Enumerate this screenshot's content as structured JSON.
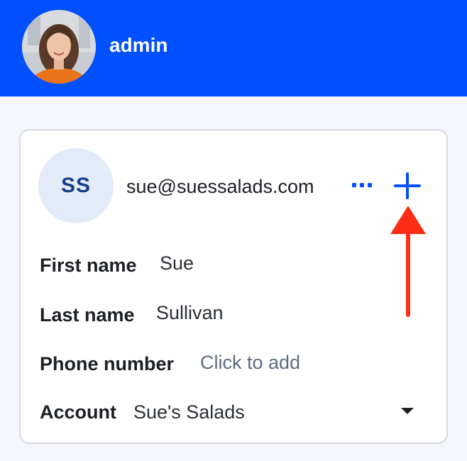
{
  "header": {
    "username": "admin",
    "background_color": "#0050ff",
    "avatar_icon": "user-photo-icon"
  },
  "contact": {
    "initials": "SS",
    "email": "sue@suessalads.com",
    "more_icon": "ellipsis-icon",
    "add_icon": "plus-icon",
    "accent_color": "#0050ff",
    "annotation_icon": "red-arrow-icon",
    "annotation_color": "#ff2d16",
    "fields": {
      "first_name": {
        "label": "First name",
        "value": "Sue"
      },
      "last_name": {
        "label": "Last name",
        "value": "Sullivan"
      },
      "phone": {
        "label": "Phone number",
        "placeholder": "Click to add"
      },
      "account": {
        "label": "Account",
        "value": "Sue's Salads",
        "icon": "caret-down-icon"
      }
    }
  }
}
